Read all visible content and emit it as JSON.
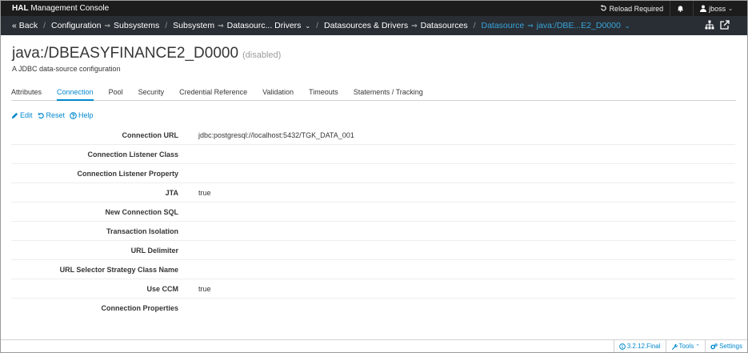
{
  "topbar": {
    "brand_bold": "HAL",
    "brand_rest": " Management Console",
    "reload": "Reload Required",
    "user": "jboss"
  },
  "breadcrumb": {
    "back": "« Back",
    "configuration": "Configuration",
    "subsystems": "Subsystems",
    "subsystem": "Subsystem",
    "subsystem_value": "Datasourc... Drivers",
    "group": "Datasources & Drivers",
    "group_value": "Datasources",
    "datasource": "Datasource",
    "datasource_value": "java:/DBE...E2_D0000"
  },
  "page": {
    "title": "java:/DBEASYFINANCE2_D0000",
    "status": "(disabled)",
    "subtitle": "A JDBC data-source configuration"
  },
  "tabs": [
    "Attributes",
    "Connection",
    "Pool",
    "Security",
    "Credential Reference",
    "Validation",
    "Timeouts",
    "Statements / Tracking"
  ],
  "active_tab": "Connection",
  "actions": {
    "edit": "Edit",
    "reset": "Reset",
    "help": "Help"
  },
  "properties": [
    {
      "label": "Connection URL",
      "value": "jdbc:postgresql://localhost:5432/TGK_DATA_001"
    },
    {
      "label": "Connection Listener Class",
      "value": ""
    },
    {
      "label": "Connection Listener Property",
      "value": ""
    },
    {
      "label": "JTA",
      "value": "true"
    },
    {
      "label": "New Connection SQL",
      "value": ""
    },
    {
      "label": "Transaction Isolation",
      "value": ""
    },
    {
      "label": "URL Delimiter",
      "value": ""
    },
    {
      "label": "URL Selector Strategy Class Name",
      "value": ""
    },
    {
      "label": "Use CCM",
      "value": "true"
    },
    {
      "label": "Connection Properties",
      "value": ""
    }
  ],
  "footer": {
    "version": "3.2.12.Final",
    "tools": "Tools",
    "settings": "Settings"
  },
  "colors": {
    "topbar": "#1c1c1c",
    "navbar": "#292e34",
    "accent": "#0088ce",
    "active_crumb": "#39a5dc"
  },
  "icons": [
    "reload-icon",
    "bell-icon",
    "user-icon",
    "sitemap-icon",
    "external-link-icon",
    "pencil-icon",
    "undo-icon",
    "help-circle-icon",
    "info-icon",
    "wrench-icon",
    "cogs-icon"
  ]
}
